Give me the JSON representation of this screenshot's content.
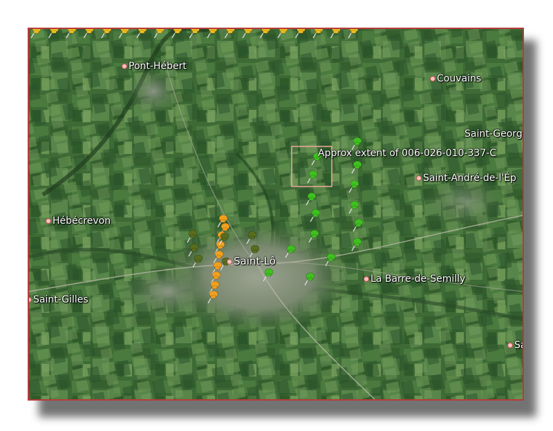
{
  "map": {
    "colors": {
      "frame": "#b83a3a",
      "pin_yellow": "#f0c020",
      "pin_orange": "#f0a020",
      "pin_green": "#40c020",
      "pin_dark": "#586e1e",
      "extent_box": "#f0a8a0"
    },
    "places": [
      {
        "name": "Pont-Hébert"
      },
      {
        "name": "Couvains"
      },
      {
        "name": "Saint-Georges"
      },
      {
        "name": "Saint-André-de-l'Ép"
      },
      {
        "name": "Hébécrevon"
      },
      {
        "name": "Saint-Lô"
      },
      {
        "name": "La Barre-de-Semilly"
      },
      {
        "name": "Saint-Gilles"
      },
      {
        "name": "Sa"
      }
    ],
    "extent_label": "Approx extent of 006-026-010-337-C",
    "pin_icon": "pushpin-icon"
  }
}
